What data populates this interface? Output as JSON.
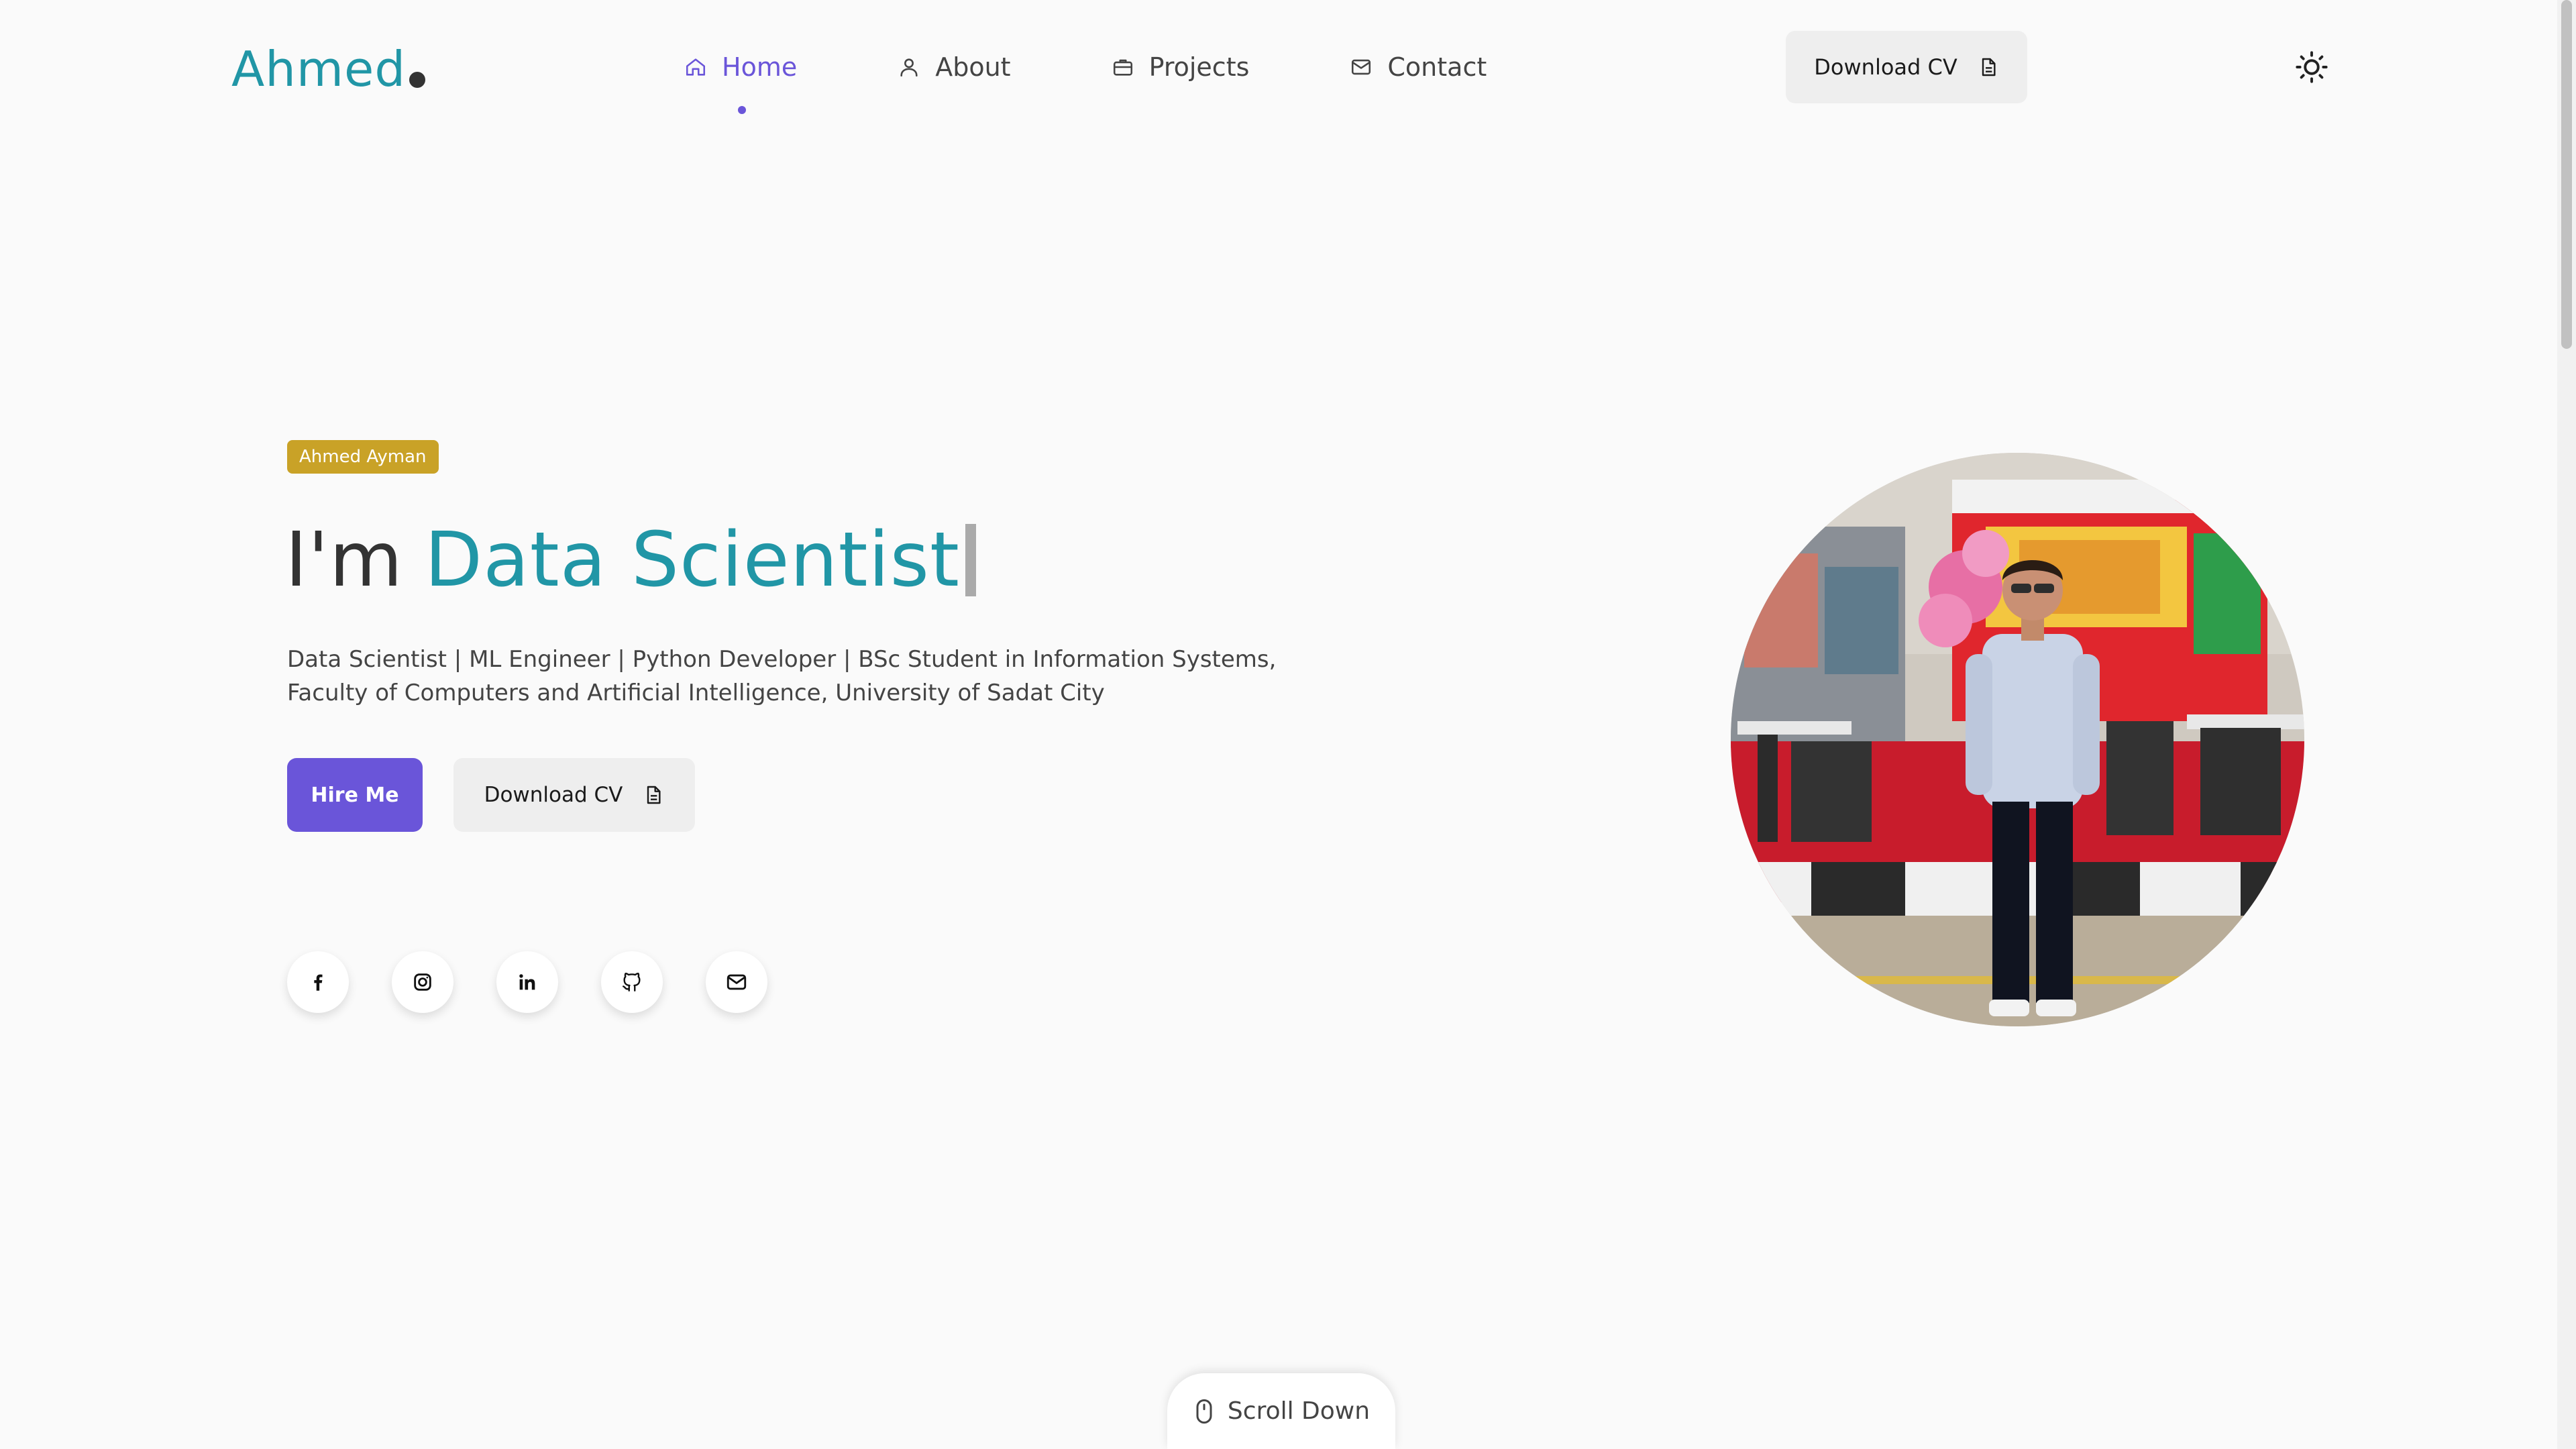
{
  "header": {
    "logo": "Ahmed",
    "nav": [
      {
        "label": "Home",
        "icon": "home-icon",
        "active": true
      },
      {
        "label": "About",
        "icon": "user-icon",
        "active": false
      },
      {
        "label": "Projects",
        "icon": "briefcase-icon",
        "active": false
      },
      {
        "label": "Contact",
        "icon": "mail-icon",
        "active": false
      }
    ],
    "download_cv_label": "Download CV",
    "theme_toggle_icon": "sun-icon"
  },
  "hero": {
    "badge": "Ahmed Ayman",
    "headline_prefix": "I'm",
    "headline_role": "Data Scientist",
    "description_line1": "Data Scientist | ML Engineer | Python Developer | BSc Student in Information Systems,",
    "description_line2": "Faculty of Computers and Artificial Intelligence, University of Sadat City",
    "hire_label": "Hire Me",
    "download_cv_label": "Download CV",
    "socials": [
      {
        "icon": "facebook-icon"
      },
      {
        "icon": "instagram-icon"
      },
      {
        "icon": "linkedin-icon"
      },
      {
        "icon": "github-icon"
      },
      {
        "icon": "mail-icon"
      }
    ]
  },
  "scroll_down_label": "Scroll Down",
  "colors": {
    "accent": "#2196a6",
    "primary": "#6a55d9",
    "badge": "#c9a227",
    "background": "#fafafa"
  }
}
